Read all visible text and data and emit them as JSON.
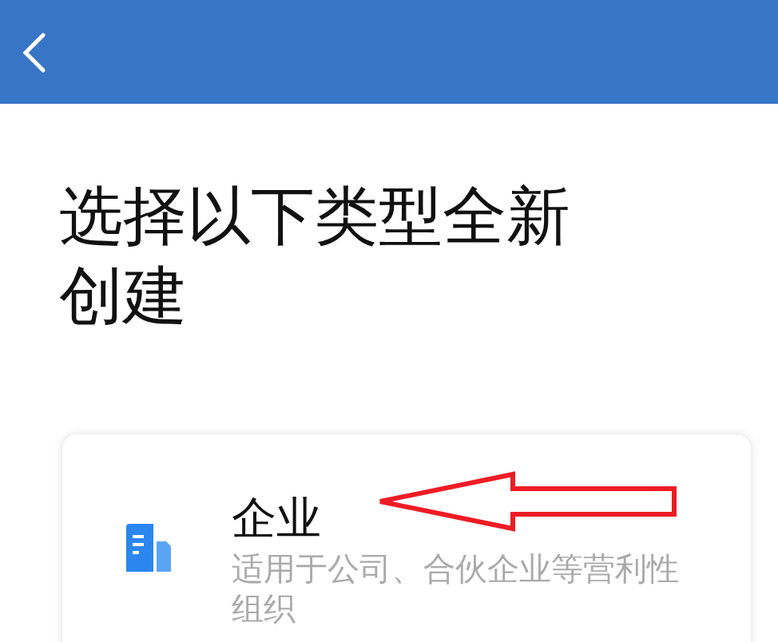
{
  "header": {
    "kind": "back"
  },
  "heading": "选择以下类型全新创建",
  "options": [
    {
      "kind": "enterprise",
      "title": "企业",
      "description": "适用于公司、合伙企业等营利性组织"
    }
  ],
  "annotation": {
    "kind": "arrow"
  }
}
